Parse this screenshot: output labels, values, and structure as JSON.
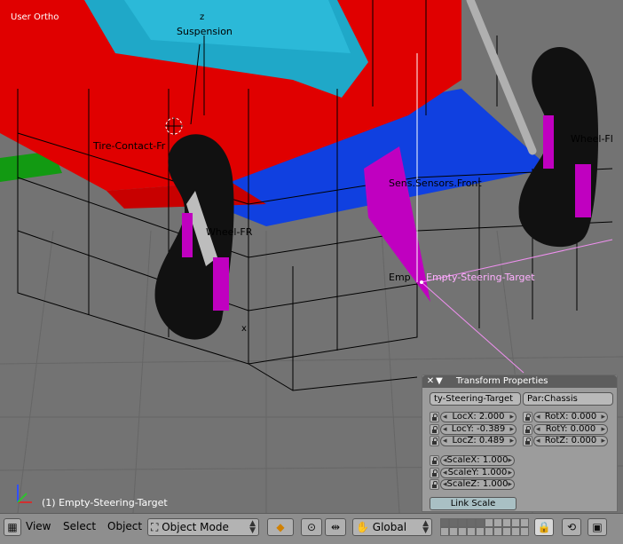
{
  "viewport": {
    "view_label": "User Ortho",
    "status": "(1) Empty-Steering-Target",
    "scene_labels": {
      "suspension": "Suspension",
      "tire_contact": "Tire-Contact-Fr",
      "wheel_fr": "Wheel-FR",
      "wheel_fl": "Wheel-Fl",
      "sensors": "Sens.Sensors.Front",
      "empty_dup": "Emp",
      "empty_target": "Empty-Steering-Target",
      "axis_z": "z",
      "axis_x": "x"
    },
    "colors": {
      "body_red": "#e00000",
      "glass_cyan": "#1fa8c8",
      "floor_blue": "#1040e0",
      "magenta": "#c000c0",
      "tire": "#111111",
      "green": "#129a12"
    }
  },
  "panel": {
    "title": "Transform Properties",
    "close_icon": "close-icon",
    "collapse_icon": "triangle-down-icon",
    "object_name": "ty-Steering-Target",
    "parent": "Par:Chassis",
    "loc": [
      {
        "label": "LocX: 2.000"
      },
      {
        "label": "LocY: -0.389"
      },
      {
        "label": "LocZ: 0.489"
      }
    ],
    "rot": [
      {
        "label": "RotX: 0.000"
      },
      {
        "label": "RotY: 0.000"
      },
      {
        "label": "RotZ: 0.000"
      }
    ],
    "scale": [
      {
        "label": "ScaleX: 1.000"
      },
      {
        "label": "ScaleY: 1.000"
      },
      {
        "label": "ScaleZ: 1.000"
      }
    ],
    "link_scale": "Link Scale"
  },
  "toolbar": {
    "menus": [
      "View",
      "Select",
      "Object"
    ],
    "mode": "Object Mode",
    "orientation": "Global"
  }
}
